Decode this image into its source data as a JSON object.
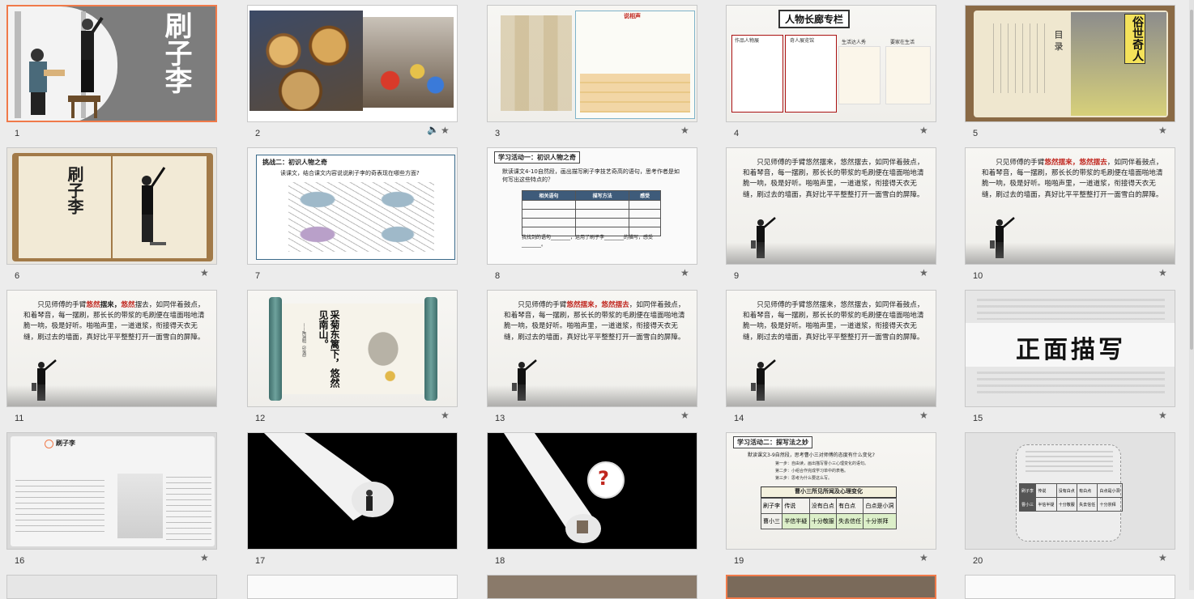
{
  "slides": [
    {
      "number": "1",
      "title": "刷子李",
      "selected": true
    },
    {
      "number": "2",
      "audio_icon": "speaker-icon"
    },
    {
      "number": "3",
      "badge": "说相声"
    },
    {
      "number": "4",
      "banner": "人物长廊专栏",
      "tags": [
        "作品人物展",
        "奇人展览馆",
        "生活达人秀",
        "要家在生活"
      ]
    },
    {
      "number": "5",
      "book_title": "俗世奇人",
      "toc": "目 录"
    },
    {
      "number": "6",
      "title": "刷子李"
    },
    {
      "number": "7",
      "header": "挑战二：初识人物之奇",
      "question": "读课文，结合课文内容说说刷子李的奇表现在哪些方面?"
    },
    {
      "number": "8",
      "header": "学习活动一：初识人物之奇",
      "task": "默读课文4-10自然段，画出描写刷子李技艺奇高的语句，思考作者是如何写出这些特点的？",
      "columns": [
        "相关语句",
        "描写方法",
        "感受"
      ],
      "footer": "我找到的语句________，运用了刷子李________的描写，感受________。"
    },
    {
      "number": "9",
      "passage": "只见师傅的手臂悠然摆来，悠然摆去，如同伴着鼓点，和着琴音，每一摆刷，那长长的带浆的毛刷便在墙面啪地清脆一响，极是好听。啪啪声里，一道道浆，衔接得天衣无缝，刷过去的墙面，真好比平平整整打开一面雪白的屏障。"
    },
    {
      "number": "10",
      "lead": "只见师傅的手臂",
      "highlight1": "悠然摆来，",
      "highlight2": "悠然摆去",
      "rest": "，如同伴着鼓点，和着琴音，每一摆刷，那长长的带浆的毛刷便在墙面啪地清脆一响，极是好听。啪啪声里，一道道浆，衔接得天衣无缝，刷过去的墙面，真好比平平整整打开一面雪白的屏障。"
    },
    {
      "number": "11",
      "lead": "只见师傅的手臂",
      "red1": "悠然",
      "mid1": "摆来，",
      "red2": "悠然",
      "rest": "摆去，如同伴着鼓点，和着琴音，每一摆刷，那长长的带浆的毛刷便在墙面啪地清脆一响，极是好听。啪啪声里，一道道浆，衔接得天衣无缝，刷过去的墙面，真好比平平整整打开一面雪白的屏障。"
    },
    {
      "number": "12",
      "poem": "采菊东篱下，悠然见南山。",
      "credit": "——陶渊明《饮酒》"
    },
    {
      "number": "13",
      "lead": "只见师傅的手臂",
      "highlight1": "悠然摆来，",
      "highlight2": "悠然摆去",
      "rest": "，如同伴着鼓点，和着琴音，每一摆刷，那长长的带浆的毛刷便在墙面啪地清脆一响，极是好听。啪啪声里，一道道浆，衔接得天衣无缝，刷过去的墙面，真好比平平整整打开一面雪白的屏障。"
    },
    {
      "number": "14",
      "passage": "只见师傅的手臂悠然摆来，悠然摆去，如同伴着鼓点，和着琴音，每一摆刷，那长长的带浆的毛刷便在墙面啪地清脆一响，极是好听。啪啪声里，一道道浆，衔接得天衣无缝，刷过去的墙面，真好比平平整整打开一面雪白的屏障。"
    },
    {
      "number": "15",
      "title": "正面描写"
    },
    {
      "number": "16",
      "heading": "刷子李"
    },
    {
      "number": "17"
    },
    {
      "number": "18",
      "mark": "?"
    },
    {
      "number": "19",
      "header": "学习活动二：探写法之妙",
      "task": "默读课文3-9自然段，思考曹小三对师傅的态度有什么变化?",
      "steps": [
        "第一步：自由读，画出描写曹小三心理变化的语句。",
        "第二步：小组合作完成学习单中的表格。",
        "第三步：思考为什么要这么写。"
      ],
      "table_title": "曹小三所见所闻及心理变化",
      "row1": [
        "刷子李",
        "传说",
        "没有白点",
        "有白点",
        "白点是小洞"
      ],
      "row2": [
        "曹小三",
        "半信半疑",
        "十分敬服",
        "失去信任",
        "十分崇拜"
      ]
    },
    {
      "number": "20",
      "row1": [
        "刷子李",
        "传说",
        "没有白点",
        "有白点",
        "白点是小洞"
      ],
      "row2": [
        "曹小三",
        "半信半疑",
        "十分敬服",
        "失去信任",
        "十分崇拜"
      ]
    }
  ],
  "colors": {
    "selection": "#f07a4a",
    "highlight_red": "#c0261e",
    "thumb_border": "#c8c8c8",
    "background": "#ececec"
  }
}
